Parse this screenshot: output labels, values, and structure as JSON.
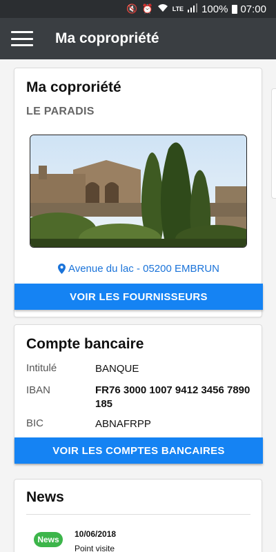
{
  "status_bar": {
    "battery": "100%",
    "time": "07:00",
    "network": "LTE"
  },
  "app_bar": {
    "title": "Ma copropriété"
  },
  "property_card": {
    "title": "Ma coproriété",
    "name": "LE PARADIS",
    "address": "Avenue du lac - 05200 EMBRUN",
    "button_label": "VOIR LES FOURNISSEURS"
  },
  "bank_card": {
    "title": "Compte bancaire",
    "rows": [
      {
        "label": "Intitulé",
        "value": "BANQUE"
      },
      {
        "label": "IBAN",
        "value": "FR76 3000 1007 9412 3456 7890 185"
      },
      {
        "label": "BIC",
        "value": "ABNAFRPP"
      }
    ],
    "button_label": "VOIR LES COMPTES BANCAIRES"
  },
  "news_card": {
    "title": "News",
    "items": [
      {
        "badge": "News",
        "date": "10/06/2018",
        "text": "Point visite"
      }
    ]
  },
  "colors": {
    "primary_button": "#1583f3",
    "app_bar": "#3a3e42",
    "link": "#1a73d9",
    "badge": "#3cb54a"
  }
}
